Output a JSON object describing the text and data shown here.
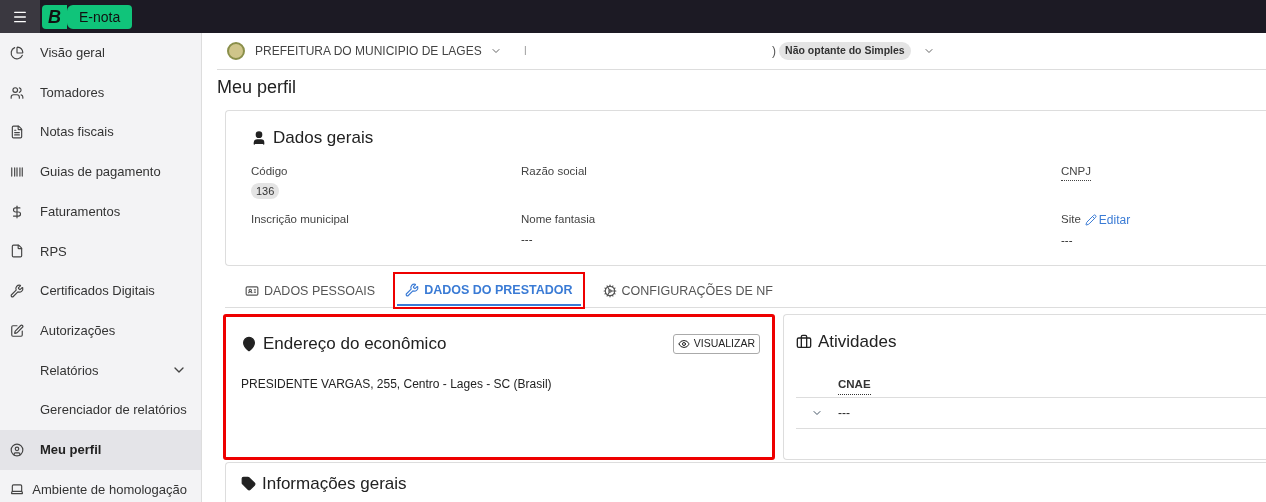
{
  "topbar": {
    "logo_letter": "B",
    "app_name": "E-nota"
  },
  "sidebar": {
    "items": [
      {
        "label": "Visão geral",
        "kind": "link",
        "selected": false
      },
      {
        "label": "Tomadores",
        "kind": "link",
        "selected": false
      },
      {
        "label": "Notas fiscais",
        "kind": "link",
        "selected": false
      },
      {
        "label": "Guias de pagamento",
        "kind": "link",
        "selected": false
      },
      {
        "label": "Faturamentos",
        "kind": "link",
        "selected": false
      },
      {
        "label": "RPS",
        "kind": "link",
        "selected": false
      },
      {
        "label": "Certificados Digitais",
        "kind": "link",
        "selected": false
      },
      {
        "label": "Autorizações",
        "kind": "link",
        "selected": false
      },
      {
        "label": "Relatórios",
        "kind": "group",
        "expanded": false,
        "selected": false
      },
      {
        "label": "Gerenciador de relatórios",
        "kind": "sublink",
        "selected": false
      },
      {
        "label": "Meu perfil",
        "kind": "link",
        "selected": true
      },
      {
        "label": "Ambiente de homologação",
        "kind": "link",
        "selected": false
      }
    ]
  },
  "header": {
    "municipality": "PREFEITURA DO MUNICIPIO DE LAGES",
    "fragment_left": "I",
    "fragment_right": ")",
    "regime": "Não optante do Simples"
  },
  "page_title": "Meu perfil",
  "general_card": {
    "title": "Dados gerais",
    "fields": [
      {
        "label": "Código",
        "value": "136",
        "kind": "badge"
      },
      {
        "label": "Razão social",
        "kind": "text"
      },
      {
        "label": "CNPJ",
        "kind": "abbr"
      },
      {
        "label": "Inscrição municipal",
        "kind": "text"
      },
      {
        "label": "Nome fantasia",
        "value": "---",
        "kind": "text"
      },
      {
        "label": "Site",
        "value": "---",
        "kind": "editable",
        "action": "Editar"
      }
    ]
  },
  "tabs": [
    {
      "label": "DADOS PESSOAIS",
      "selected": false,
      "highlighted": false
    },
    {
      "label": "DADOS DO PRESTADOR",
      "selected": true,
      "highlighted": true
    },
    {
      "label": "CONFIGURAÇÕES DE NF",
      "selected": false,
      "highlighted": false
    }
  ],
  "address_card": {
    "title": "Endereço do econômico",
    "button": "VISUALIZAR",
    "address": "PRESIDENTE VARGAS, 255, Centro - Lages - SC (Brasil)",
    "highlighted": true
  },
  "activities_card": {
    "title": "Atividades",
    "table": {
      "columns": [
        "CNAE"
      ],
      "rows": [
        {
          "expanded": false,
          "cells": [
            "---"
          ]
        }
      ]
    }
  },
  "info_card": {
    "title": "Informações gerais"
  }
}
